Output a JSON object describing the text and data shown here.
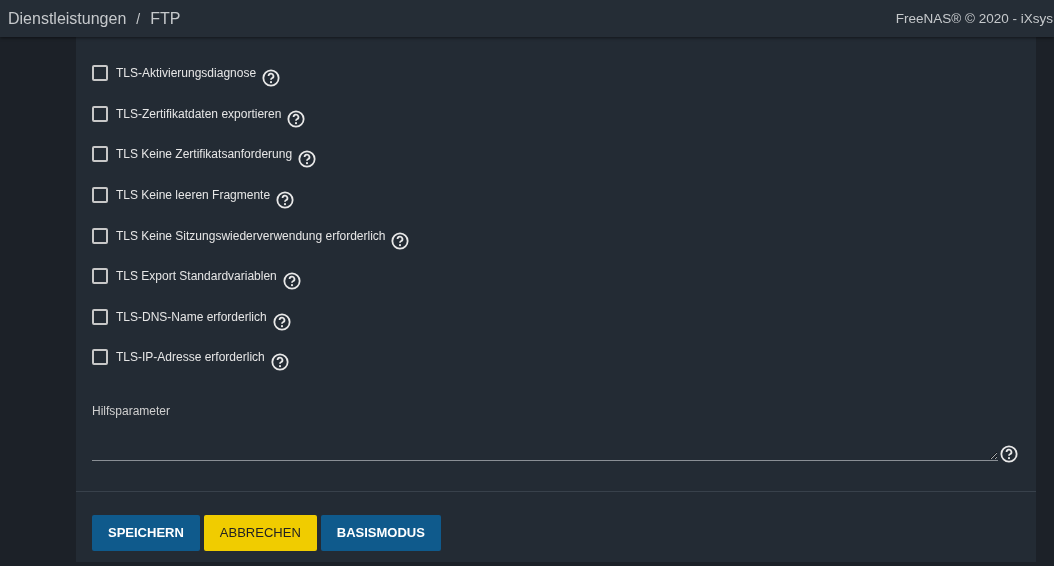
{
  "header": {
    "breadcrumb": [
      "Dienstleistungen",
      "FTP"
    ],
    "separator": "/",
    "copyright": "FreeNAS® © 2020 - iXsys"
  },
  "options": [
    {
      "label": "TLS-Aktivierungsdiagnose",
      "checked": false
    },
    {
      "label": "TLS-Zertifikatdaten exportieren",
      "checked": false
    },
    {
      "label": "TLS Keine Zertifikatsanforderung",
      "checked": false
    },
    {
      "label": "TLS Keine leeren Fragmente",
      "checked": false
    },
    {
      "label": "TLS Keine Sitzungswiederverwendung erforderlich",
      "checked": false
    },
    {
      "label": "TLS Export Standardvariablen",
      "checked": false
    },
    {
      "label": "TLS-DNS-Name erforderlich",
      "checked": false
    },
    {
      "label": "TLS-IP-Adresse erforderlich",
      "checked": false
    }
  ],
  "aux_field": {
    "label": "Hilfsparameter"
  },
  "buttons": [
    {
      "label": "SPEICHERN",
      "kind": "primary"
    },
    {
      "label": "ABBRECHEN",
      "kind": "warning"
    },
    {
      "label": "BASISMODUS",
      "kind": "primary"
    }
  ]
}
